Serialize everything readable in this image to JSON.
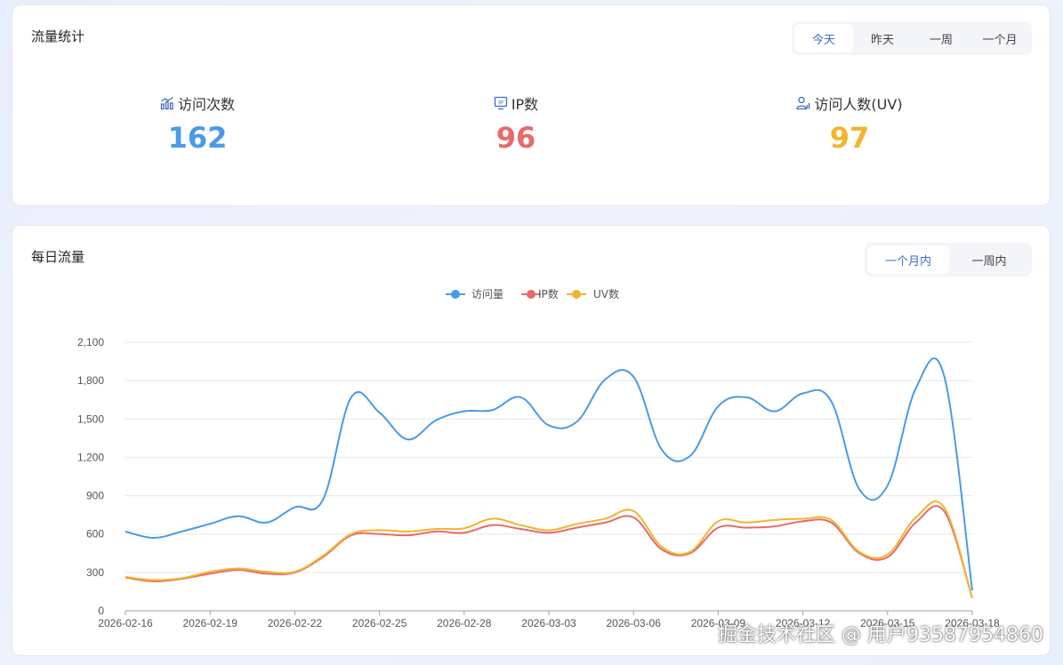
{
  "traffic": {
    "title": "流量统计",
    "ranges": [
      "今天",
      "昨天",
      "一周",
      "一个月"
    ],
    "active_range": 0,
    "stats": [
      {
        "label": "访问次数",
        "value": "162",
        "color": "#4a9ae8",
        "icon": "bar-chart-icon"
      },
      {
        "label": "IP数",
        "value": "96",
        "color": "#e86a6a",
        "icon": "monitor-icon"
      },
      {
        "label": "访问人数(UV)",
        "value": "97",
        "color": "#f0b530",
        "icon": "user-chart-icon"
      }
    ]
  },
  "daily": {
    "title": "每日流量",
    "ranges": [
      "一个月内",
      "一周内"
    ],
    "active_range": 0
  },
  "chart_data": {
    "type": "line",
    "x": [
      "2026-02-16",
      "2026-02-17",
      "2026-02-18",
      "2026-02-19",
      "2026-02-20",
      "2026-02-21",
      "2026-02-22",
      "2026-02-23",
      "2026-02-24",
      "2026-02-25",
      "2026-02-26",
      "2026-02-27",
      "2026-02-28",
      "2026-03-01",
      "2026-03-02",
      "2026-03-03",
      "2026-03-04",
      "2026-03-05",
      "2026-03-06",
      "2026-03-07",
      "2026-03-08",
      "2026-03-09",
      "2026-03-10",
      "2026-03-11",
      "2026-03-12",
      "2026-03-13",
      "2026-03-14",
      "2026-03-15",
      "2026-03-16",
      "2026-03-17",
      "2026-03-18"
    ],
    "xticks": [
      "2026-02-16",
      "2026-02-19",
      "2026-02-22",
      "2026-02-25",
      "2026-02-28",
      "2026-03-03",
      "2026-03-06",
      "2026-03-09",
      "2026-03-12",
      "2026-03-15",
      "2026-03-18"
    ],
    "series": [
      {
        "name": "访问量",
        "color": "#4a9ae8",
        "values": [
          620,
          570,
          620,
          680,
          740,
          690,
          810,
          870,
          1670,
          1550,
          1340,
          1490,
          1560,
          1570,
          1670,
          1450,
          1480,
          1810,
          1830,
          1260,
          1210,
          1600,
          1670,
          1560,
          1700,
          1640,
          950,
          980,
          1740,
          1840,
          160
        ]
      },
      {
        "name": "IP数",
        "color": "#e86a6a",
        "values": [
          260,
          230,
          250,
          290,
          320,
          290,
          300,
          420,
          590,
          600,
          590,
          620,
          610,
          670,
          640,
          610,
          650,
          690,
          730,
          480,
          450,
          650,
          650,
          660,
          700,
          690,
          450,
          420,
          690,
          780,
          100
        ]
      },
      {
        "name": "UV数",
        "color": "#f0b530",
        "values": [
          265,
          240,
          255,
          305,
          330,
          305,
          305,
          430,
          600,
          630,
          620,
          640,
          645,
          720,
          670,
          630,
          680,
          720,
          780,
          500,
          460,
          700,
          690,
          710,
          720,
          710,
          460,
          440,
          730,
          810,
          100
        ]
      }
    ],
    "ylim": [
      0,
      2100
    ],
    "yticks": [
      0,
      300,
      600,
      900,
      1200,
      1500,
      1800,
      2100
    ],
    "grid": true,
    "legend": "top-center"
  },
  "watermark": "掘金技术社区 @ 用户93587954860"
}
